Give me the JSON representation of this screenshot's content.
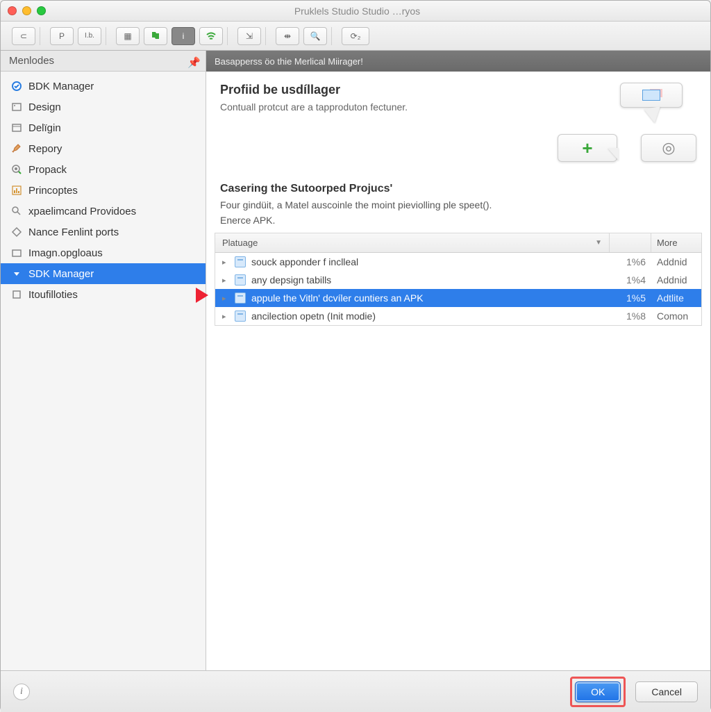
{
  "window": {
    "title": "Pruklels Studio Studio …ryos"
  },
  "sidebar": {
    "header": "Menlodes",
    "items": [
      {
        "label": "BDK Manager"
      },
      {
        "label": "Design"
      },
      {
        "label": "Delïgin"
      },
      {
        "label": "Repory"
      },
      {
        "label": "Propack"
      },
      {
        "label": "Princoptes"
      },
      {
        "label": "xpaelimcand Providoes"
      },
      {
        "label": "Nance Fenlint ports"
      },
      {
        "label": "Imagn.opgloaus"
      },
      {
        "label": "SDK Manager"
      },
      {
        "label": "Itoufilloties"
      }
    ],
    "selected_index": 9
  },
  "content": {
    "crumb": "Basapperss öo thie Merlical Miirager!",
    "hero_title": "Profiid be usdíllager",
    "hero_sub": "Contuall protcut are a tapproduton fectuner.",
    "section_title": "Casering the Sutoorped Projucs'",
    "section_p1": "Four gindüit, a Matel auscoinle the moint pieviolling ple speet().",
    "section_p2": "Enerce APK."
  },
  "table": {
    "columns": {
      "name": "Platuage",
      "more": "More"
    },
    "rows": [
      {
        "name": "souck apponder f inclleal",
        "ver": "1%6",
        "act": "Addnid"
      },
      {
        "name": "any depsign tabills",
        "ver": "1%4",
        "act": "Addnid"
      },
      {
        "name": "appule the Vitln' dcvíler cuntiers an APK",
        "ver": "1%5",
        "act": "Adtlite"
      },
      {
        "name": "ancilection opetn (Init modie)",
        "ver": "1%8",
        "act": "Comon"
      }
    ],
    "selected_index": 2
  },
  "footer": {
    "ok": "OK",
    "cancel": "Cancel"
  }
}
